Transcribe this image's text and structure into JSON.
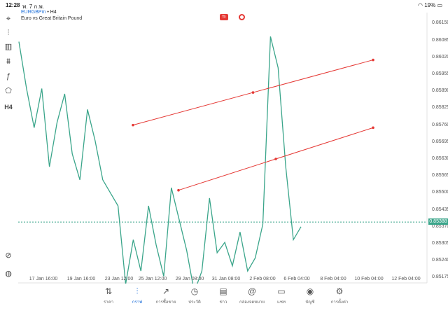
{
  "status_bar": {
    "time": "12:28",
    "date": "พ. 7 ก.พ.",
    "battery": "19%"
  },
  "symbol": {
    "name": "EURGBPm",
    "timeframe": "H4",
    "description": "Euro vs Great Britain Pound"
  },
  "tools": [
    {
      "icon": "crosshair-icon",
      "glyph": "⌖"
    },
    {
      "icon": "candles-icon",
      "glyph": "⫶"
    },
    {
      "icon": "bar-chart-icon",
      "glyph": "▥"
    },
    {
      "icon": "sliders-icon",
      "glyph": "⩩"
    },
    {
      "icon": "function-icon",
      "glyph": "ƒ"
    },
    {
      "icon": "shapes-icon",
      "glyph": "⬠"
    },
    {
      "icon": "timeframe",
      "label": "H4"
    }
  ],
  "price_axis": [
    "0.86150",
    "0.86085",
    "0.86020",
    "0.85955",
    "0.85890",
    "0.85825",
    "0.85760",
    "0.85695",
    "0.85630",
    "0.85565",
    "0.85500",
    "0.85435",
    "0.85370",
    "0.85305",
    "0.85240",
    "0.85175"
  ],
  "current_price": "0.85388",
  "time_axis": [
    "17 Jan 16:00",
    "19 Jan 16:00",
    "23 Jan 12:00",
    "25 Jan 12:00",
    "29 Jan 08:00",
    "31 Jan 08:00",
    "2 Feb 08:00",
    "6 Feb 04:00",
    "8 Feb 04:00",
    "10 Feb 04:00",
    "12 Feb 04:00"
  ],
  "colors": {
    "line": "#3aa58a",
    "trendline": "#e53935",
    "accent": "#1e6fd9"
  },
  "nav": [
    {
      "label": "ราคา",
      "icon": "quotes-icon",
      "glyph": "⇅"
    },
    {
      "label": "กราฟ",
      "icon": "chart-icon",
      "glyph": "⫶",
      "active": true
    },
    {
      "label": "การซื้อขาย",
      "icon": "trade-icon",
      "glyph": "↗"
    },
    {
      "label": "ประวัติ",
      "icon": "history-icon",
      "glyph": "◷"
    },
    {
      "label": "ข่าว",
      "icon": "news-icon",
      "glyph": "▤"
    },
    {
      "label": "กล่องจดหมาย",
      "icon": "mail-icon",
      "glyph": "@"
    },
    {
      "label": "แชท",
      "icon": "chat-icon",
      "glyph": "▭"
    },
    {
      "label": "บัญชี",
      "icon": "account-icon",
      "glyph": "◉"
    },
    {
      "label": "การตั้งค่า",
      "icon": "settings-icon",
      "glyph": "⚙"
    }
  ],
  "chart_data": {
    "type": "line",
    "x": [
      "17 Jan 16:00",
      "19 Jan 16:00",
      "23 Jan 12:00",
      "25 Jan 12:00",
      "29 Jan 08:00",
      "31 Jan 08:00",
      "2 Feb 08:00",
      "6 Feb 04:00"
    ],
    "series": [
      {
        "values": [
          0.8608,
          0.859,
          0.8575,
          0.859,
          0.856,
          0.8577,
          0.8588,
          0.8565,
          0.8555,
          0.8582,
          0.857,
          0.8555,
          0.855,
          0.8545,
          0.8515,
          0.8532,
          0.852,
          0.8545,
          0.853,
          0.8518,
          0.8552,
          0.854,
          0.8528,
          0.8512,
          0.852,
          0.8548,
          0.8527,
          0.8531,
          0.8522,
          0.8535,
          0.852,
          0.8525,
          0.8538,
          0.861,
          0.8598,
          0.856,
          0.8532,
          0.8537
        ]
      }
    ],
    "trendlines": [
      {
        "from": [
          "25 Jan 12:00",
          0.8576
        ],
        "to": [
          "10 Feb 04:00",
          0.8601
        ]
      },
      {
        "from": [
          "29 Jan 08:00",
          0.8551
        ],
        "to": [
          "10 Feb 04:00",
          0.8575
        ]
      }
    ],
    "current_price": 0.85388,
    "ylim": [
      0.8516,
      0.8617
    ]
  }
}
